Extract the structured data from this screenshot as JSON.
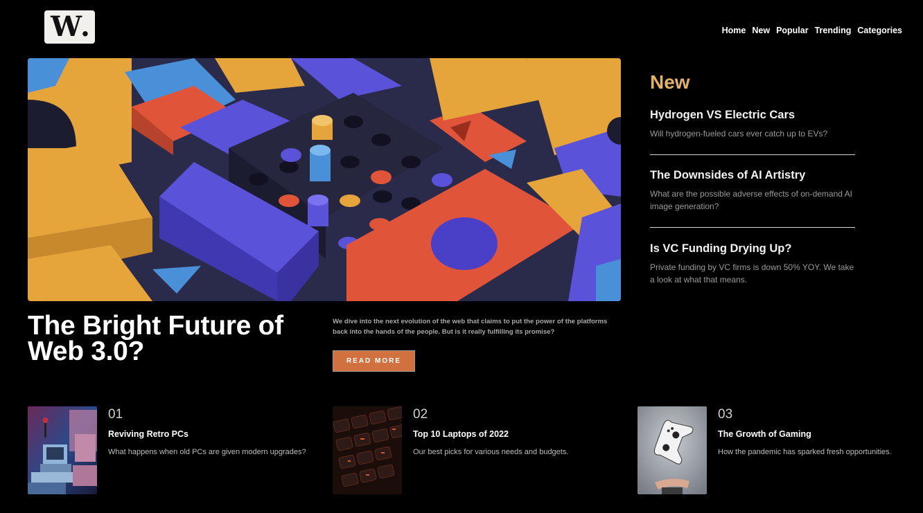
{
  "logo": {
    "text": "W",
    "dot": "."
  },
  "nav": [
    "Home",
    "New",
    "Popular",
    "Trending",
    "Categories"
  ],
  "hero": {
    "title": "The Bright Future of Web 3.0?",
    "description": "We dive into the next evolution of the web that claims to put the power of the platforms back into the hands of the people. But is it really fulfilling its promise?",
    "button_label": "READ MORE",
    "image_icon": "abstract-3d-blocks-image"
  },
  "new_section": {
    "heading": "New",
    "items": [
      {
        "title": "Hydrogen VS Electric Cars",
        "desc": "Will hydrogen-fueled cars ever catch up to EVs?"
      },
      {
        "title": "The Downsides of AI Artistry",
        "desc": "What are the possible adverse effects of on-demand AI image generation?"
      },
      {
        "title": "Is VC Funding Drying Up?",
        "desc": "Private funding by VC firms is down 50% YOY. We take a look at what that means."
      }
    ]
  },
  "cards": [
    {
      "num": "01",
      "title": "Reviving Retro PCs",
      "desc": "What happens when old PCs are given modern upgrades?",
      "image_icon": "retro-pc-image"
    },
    {
      "num": "02",
      "title": "Top 10 Laptops of 2022",
      "desc": "Our best picks for various needs and budgets.",
      "image_icon": "laptop-keyboard-image"
    },
    {
      "num": "03",
      "title": "The Growth of Gaming",
      "desc": "How the pandemic has sparked fresh opportunities.",
      "image_icon": "game-controller-image"
    }
  ],
  "colors": {
    "background": "#000000",
    "accent_gold": "#e4b363",
    "button_orange": "#d0713f"
  }
}
